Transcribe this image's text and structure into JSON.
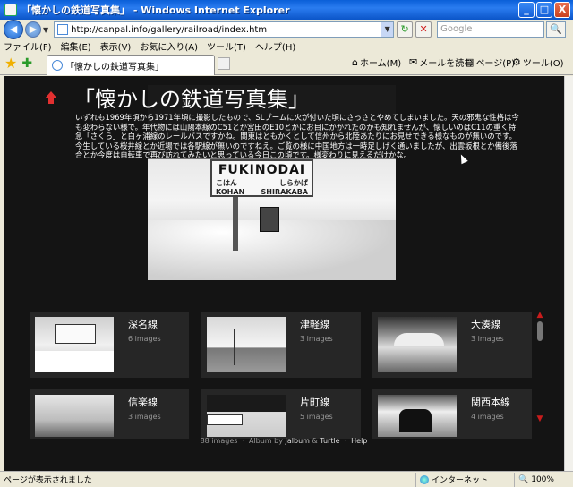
{
  "window": {
    "title": "「懐かしの鉄道写真集」 - Windows Internet Explorer",
    "buttons": {
      "minimize": "_",
      "maximize": "□",
      "close": "X"
    }
  },
  "nav": {
    "back": "◀",
    "forward": "▶",
    "dropdown": "▼",
    "url": "http://canpal.info/gallery/railroad/index.htm",
    "search_placeholder": "Google",
    "refresh_glyph": "↻",
    "stop_glyph": "✕",
    "search_glyph": "🔍"
  },
  "menu": [
    "ファイル(F)",
    "編集(E)",
    "表示(V)",
    "お気に入り(A)",
    "ツール(T)",
    "ヘルプ(H)"
  ],
  "toolbar": {
    "tab_title": "「懐かしの鉄道写真集」",
    "home": "ホーム(M)",
    "mail": "メールを読む",
    "page": "ページ(P)",
    "tools": "ツール(O)"
  },
  "gallery": {
    "title": "「懐かしの鉄道写真集」",
    "description": "いずれも1969年頃から1971年頃に撮影したもので、SLブームに火が付いた頃にさっさとやめてしまいました。天の邪鬼な性格は今も変わらない様で。年代物には山陽本線のC51とか宮田のE10とかにお目にかかれたのかも知れませんが、懐しいのはC11の重く特急「さくら」と白ヶ浦線のレールバスですかね。関東はともかくとして信州から北陸あたりにお見せできる様なものが無いのです。今生している桜井線とか近場では各駅線が無いのですねえ。ご覧の様に中国地方は一時足しげく通いましたが、出雲坂根とか備後落合とか今度は自転車で再び訪れてみたいと思っている今日この頃です。様変わりに見えるだけかな。",
    "featured_sign": {
      "main": "FUKINODAI",
      "left": "こはん",
      "right": "しらかば",
      "left_roman": "KOHAN",
      "right_roman": "SHIRAKABA"
    }
  },
  "albums": [
    {
      "name": "深名線",
      "count": "6 images"
    },
    {
      "name": "津軽線",
      "count": "3 images"
    },
    {
      "name": "大湊線",
      "count": "3 images"
    },
    {
      "name": "信楽線",
      "count": "3 images"
    },
    {
      "name": "片町線",
      "count": "5 images"
    },
    {
      "name": "関西本線",
      "count": "4 images"
    }
  ],
  "footer": {
    "images": "88 images",
    "album_by": "Album by",
    "jalbum": "Jalbum",
    "amp": "&",
    "turtle": "Turtle",
    "help": "Help"
  },
  "status": {
    "message": "ページが表示されました",
    "zone": "インターネット",
    "zoom": "100%"
  }
}
